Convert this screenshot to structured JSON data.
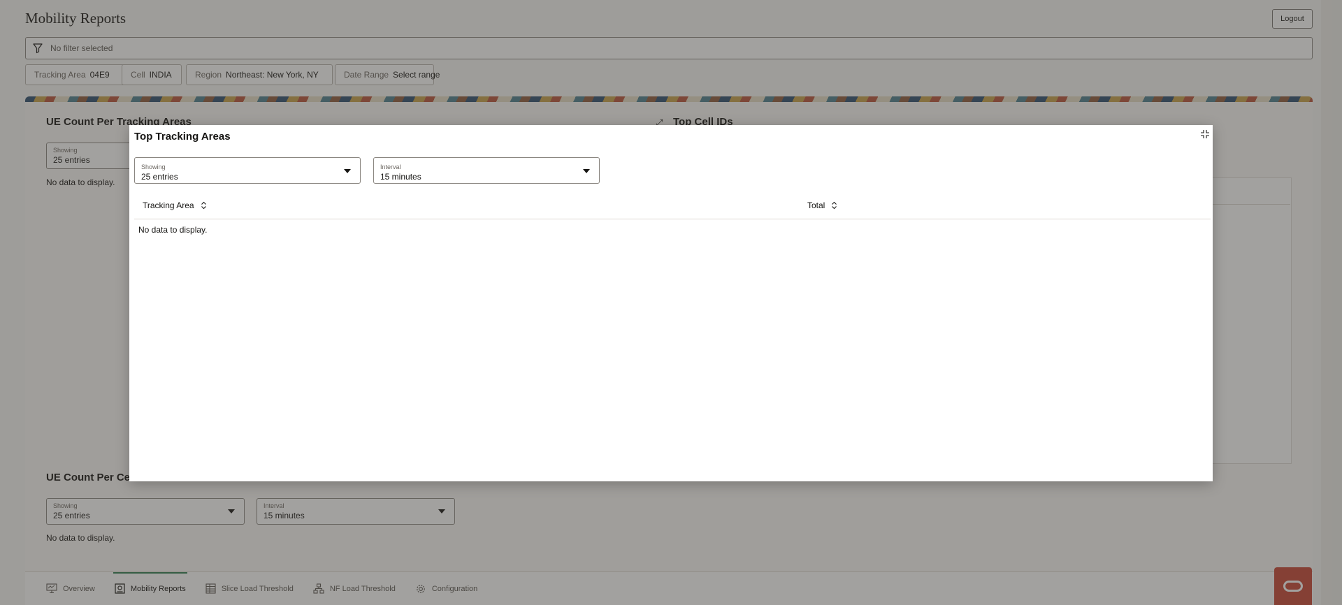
{
  "header": {
    "title": "Mobility Reports",
    "logout_label": "Logout"
  },
  "filter": {
    "placeholder_text": "No filter selected"
  },
  "chips": [
    {
      "label": "Tracking Area",
      "value": "04E9"
    },
    {
      "label": "Cell",
      "value": "INDIA"
    },
    {
      "label": "Region",
      "value": "Northeast: New York, NY"
    },
    {
      "label": "Date Range",
      "value": "Select range"
    }
  ],
  "background": {
    "ue_tracking": {
      "title": "UE Count Per Tracking Areas",
      "showing_label": "Showing",
      "showing_value": "25 entries",
      "no_data": "No data to display."
    },
    "top_cell_ids": {
      "title": "Top Cell IDs"
    },
    "ue_cell": {
      "title": "UE Count Per Cell",
      "showing_label": "Showing",
      "showing_value": "25 entries",
      "interval_label": "Interval",
      "interval_value": "15 minutes",
      "no_data": "No data to display."
    }
  },
  "modal": {
    "title": "Top Tracking Areas",
    "showing_label": "Showing",
    "showing_value": "25 entries",
    "interval_label": "Interval",
    "interval_value": "15 minutes",
    "columns": [
      "Tracking Area",
      "Total"
    ],
    "no_data": "No data to display."
  },
  "nav": {
    "items": [
      {
        "label": "Overview",
        "icon": "monitor-icon"
      },
      {
        "label": "Mobility Reports",
        "icon": "report-icon"
      },
      {
        "label": "Slice Load Threshold",
        "icon": "table-icon"
      },
      {
        "label": "NF Load Threshold",
        "icon": "hierarchy-icon"
      },
      {
        "label": "Configuration",
        "icon": "gear-icon"
      }
    ],
    "active_index": 1
  },
  "colors": {
    "accent_active": "#2f7d4f",
    "oracle_red": "#c74634",
    "overlay": "rgba(60,58,54,0.48)"
  }
}
